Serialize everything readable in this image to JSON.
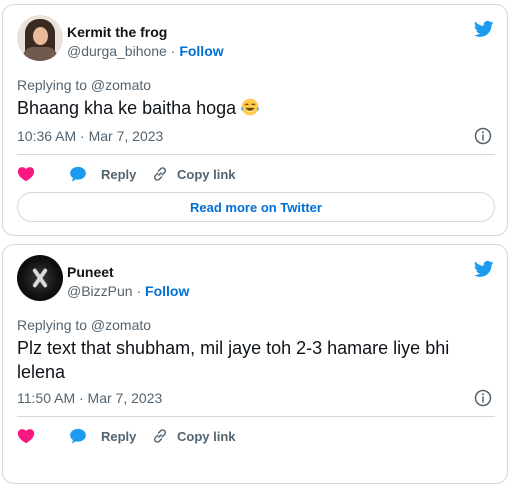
{
  "colors": {
    "like": "#f91880",
    "reply": "#1d9bf0",
    "follow": "#006fd6",
    "twitter_blue": "#1d9bf0",
    "text": "#0f1419",
    "muted": "#536471"
  },
  "tweets": [
    {
      "author_name": "Kermit the frog",
      "handle": "@durga_bihone",
      "separator": "·",
      "follow_label": "Follow",
      "replying_to": "Replying to @zomato",
      "text": "Bhaang kha ke baitha hoga",
      "text_emoji": "face-with-tears-of-joy",
      "timestamp": "10:36 AM · Mar 7, 2023",
      "reply_label": "Reply",
      "copy_link_label": "Copy link",
      "read_more_label": "Read more on Twitter",
      "icons": [
        "heart-icon",
        "reply-bubble-icon",
        "link-icon",
        "twitter-bird-icon",
        "info-icon"
      ]
    },
    {
      "author_name": "Puneet",
      "handle": "@BizzPun",
      "separator": "·",
      "follow_label": "Follow",
      "replying_to": "Replying to @zomato",
      "text": "Plz text that shubham, mil jaye toh 2-3 hamare liye bhi lelena",
      "timestamp": "11:50 AM · Mar 7, 2023",
      "reply_label": "Reply",
      "copy_link_label": "Copy link",
      "icons": [
        "heart-icon",
        "reply-bubble-icon",
        "link-icon",
        "twitter-bird-icon",
        "info-icon"
      ]
    }
  ]
}
